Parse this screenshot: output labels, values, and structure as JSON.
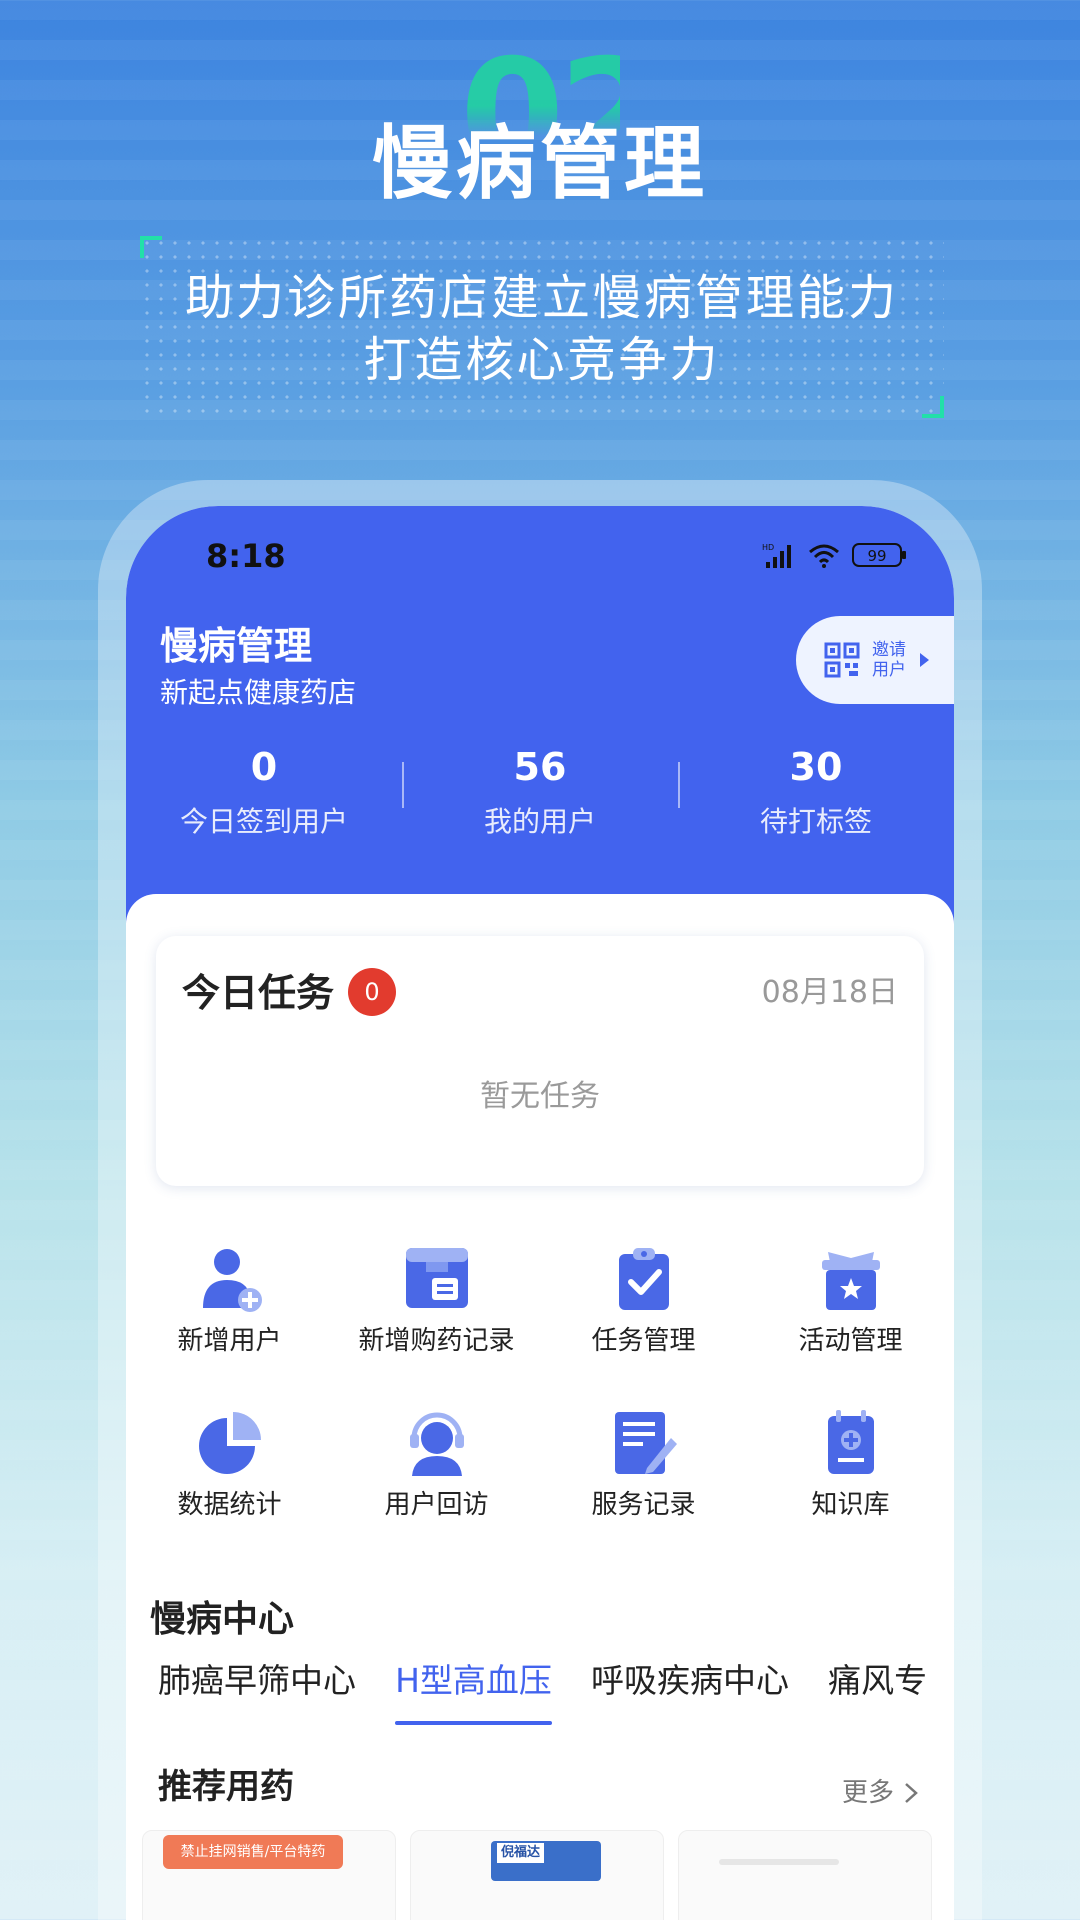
{
  "promo": {
    "bg_number": "02",
    "title": "慢病管理",
    "subtitle_line1": "助力诊所药店建立慢病管理能力",
    "subtitle_line2": "打造核心竞争力"
  },
  "status_bar": {
    "time": "8:18",
    "network": "HD",
    "battery": "99"
  },
  "header": {
    "title": "慢病管理",
    "store_name": "新起点健康药店",
    "invite_line1": "邀请",
    "invite_line2": "用户"
  },
  "stats": [
    {
      "value": "0",
      "label": "今日签到用户"
    },
    {
      "value": "56",
      "label": "我的用户"
    },
    {
      "value": "30",
      "label": "待打标签"
    }
  ],
  "task": {
    "title": "今日任务",
    "badge": "0",
    "date": "08月18日",
    "empty": "暂无任务"
  },
  "functions": [
    {
      "label": "新增用户",
      "icon": "add-user-icon"
    },
    {
      "label": "新增购药记录",
      "icon": "purchase-record-icon"
    },
    {
      "label": "任务管理",
      "icon": "task-clipboard-icon"
    },
    {
      "label": "活动管理",
      "icon": "gift-star-icon"
    },
    {
      "label": "数据统计",
      "icon": "pie-chart-icon"
    },
    {
      "label": "用户回访",
      "icon": "headset-user-icon"
    },
    {
      "label": "服务记录",
      "icon": "document-edit-icon"
    },
    {
      "label": "知识库",
      "icon": "knowledge-book-icon"
    }
  ],
  "chronic_center": {
    "title": "慢病中心",
    "tabs": [
      "肺癌早筛中心",
      "H型高血压",
      "呼吸疾病中心",
      "痛风专"
    ],
    "active_tab": 1
  },
  "recommend": {
    "title": "推荐用药",
    "more": "更多",
    "product1_banner": "禁止挂网销售/平台特药",
    "product2_brand": "倪福达"
  },
  "colors": {
    "primary": "#4263ee",
    "badge": "#e23b2e",
    "accent_green": "#22e0a8"
  }
}
